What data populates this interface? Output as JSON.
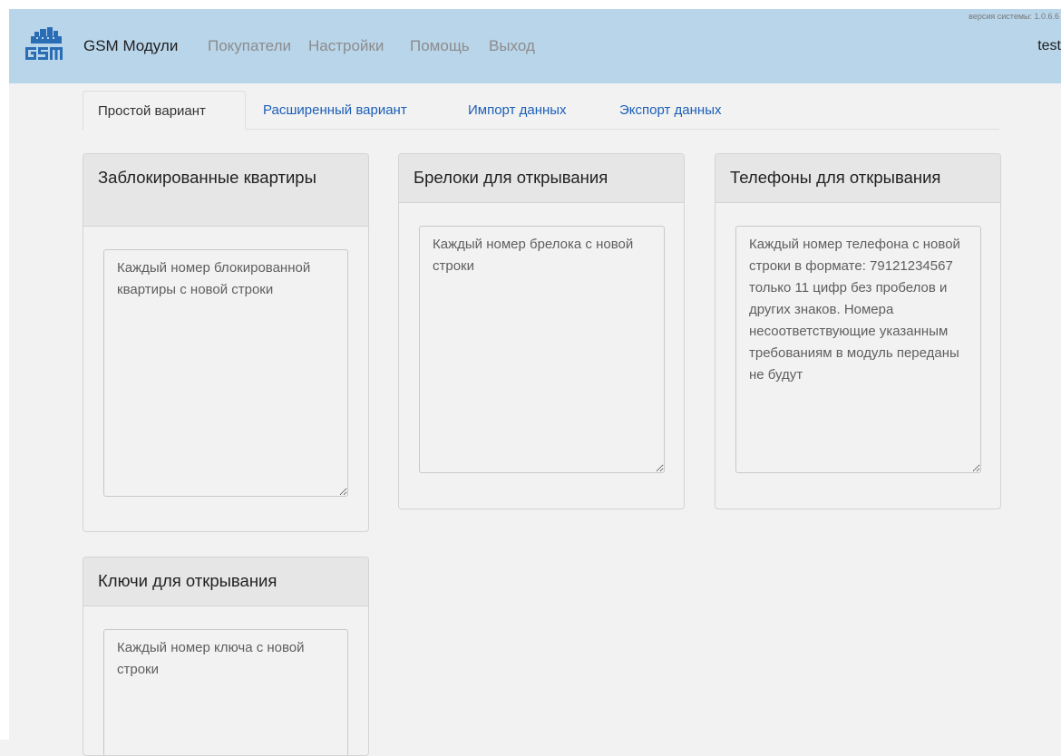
{
  "header": {
    "version": "версия системы: 1.0.6.6",
    "brand": "GSM Модули",
    "nav": [
      "Покупатели",
      "Настройки",
      "Помощь",
      "Выход"
    ],
    "user": "test"
  },
  "tabs": [
    "Простой вариант",
    "Расширенный вариант",
    "Импорт данных",
    "Экспорт данных"
  ],
  "panels": {
    "blocked": {
      "title": "Заблокированные квартиры",
      "placeholder": "Каждый номер блокированной квартиры с новой строки"
    },
    "fobs": {
      "title": "Брелоки для открывания",
      "placeholder": "Каждый номер брелока с новой строки"
    },
    "phones": {
      "title": "Телефоны для открывания",
      "placeholder": "Каждый номер телефона с новой строки в формате: 79121234567 только 11 цифр без пробелов и других знаков. Номера несоответствующие указанным требованиям в модуль переданы не будут"
    },
    "keys": {
      "title": "Ключи для открывания",
      "placeholder": "Каждый номер ключа с новой строки"
    }
  },
  "colors": {
    "navbar": "#b9d5ea",
    "link": "#1b5fb8",
    "logo": "#2a6db5"
  }
}
